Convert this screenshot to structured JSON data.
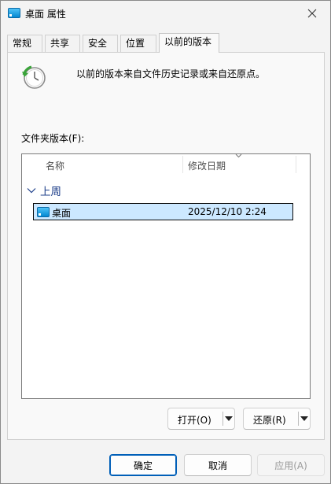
{
  "window": {
    "title": "桌面 属性",
    "close_glyph": "✕"
  },
  "tabs": [
    {
      "label": "常规",
      "active": false
    },
    {
      "label": "共享",
      "active": false
    },
    {
      "label": "安全",
      "active": false
    },
    {
      "label": "位置",
      "active": false
    },
    {
      "label": "以前的版本",
      "active": true
    }
  ],
  "panel": {
    "info_text": "以前的版本来自文件历史记录或来自还原点。",
    "folder_versions_label": "文件夹版本(F):",
    "columns": {
      "name": "名称",
      "date_modified": "修改日期"
    },
    "group": {
      "title": "上周",
      "expanded": true
    },
    "rows": [
      {
        "name": "桌面",
        "date": "2025/12/10 2:24",
        "selected": true
      }
    ],
    "open_button": "打开(O)",
    "restore_button": "还原(R)"
  },
  "footer": {
    "ok": "确定",
    "cancel": "取消",
    "apply": "应用(A)"
  },
  "colors": {
    "selection": "#cce8ff",
    "group_title": "#1e3f8a",
    "default_button_border": "#005fb8"
  }
}
